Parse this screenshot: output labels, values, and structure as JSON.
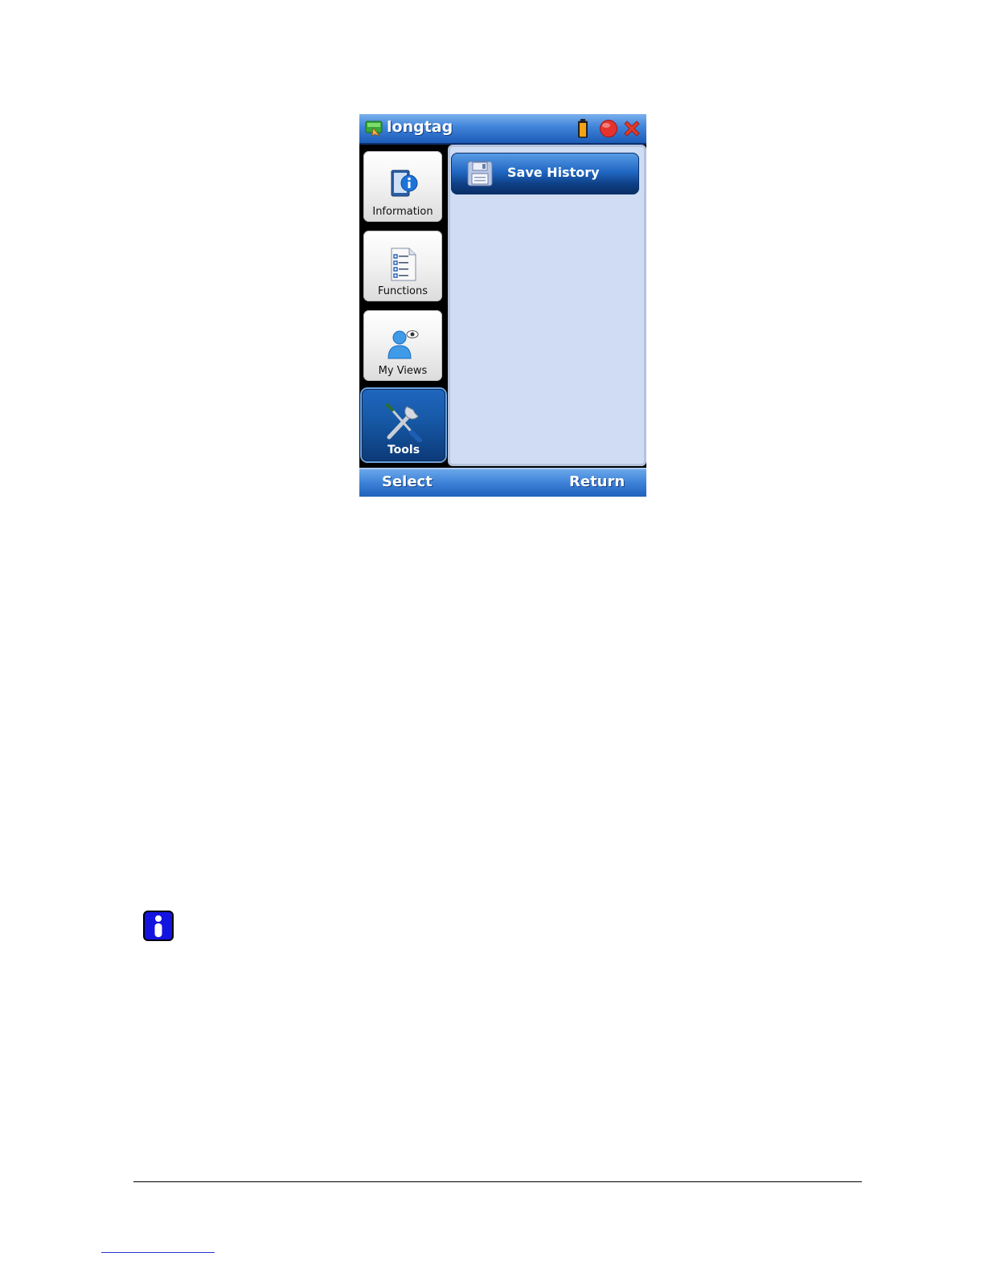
{
  "window": {
    "title": "longtag",
    "icons": [
      "app-icon",
      "battery-icon",
      "record-icon",
      "close-icon"
    ]
  },
  "nav": {
    "items": [
      {
        "label": "Information",
        "icon": "information-icon",
        "selected": false
      },
      {
        "label": "Functions",
        "icon": "functions-list-icon",
        "selected": false
      },
      {
        "label": "My Views",
        "icon": "user-view-icon",
        "selected": false
      },
      {
        "label": "Tools",
        "icon": "tools-icon",
        "selected": true
      }
    ]
  },
  "content": {
    "actions": [
      {
        "label": "Save History",
        "icon": "floppy-disk-icon"
      }
    ]
  },
  "softkeys": {
    "left": "Select",
    "right": "Return"
  },
  "document": {
    "note_icon": "info-note-icon"
  },
  "colors": {
    "titlebar": "#3f82d8",
    "content_bg": "#cfdcf3",
    "active_tab": "#175aa8",
    "close": "#e23a2a",
    "record": "#e6322d"
  }
}
